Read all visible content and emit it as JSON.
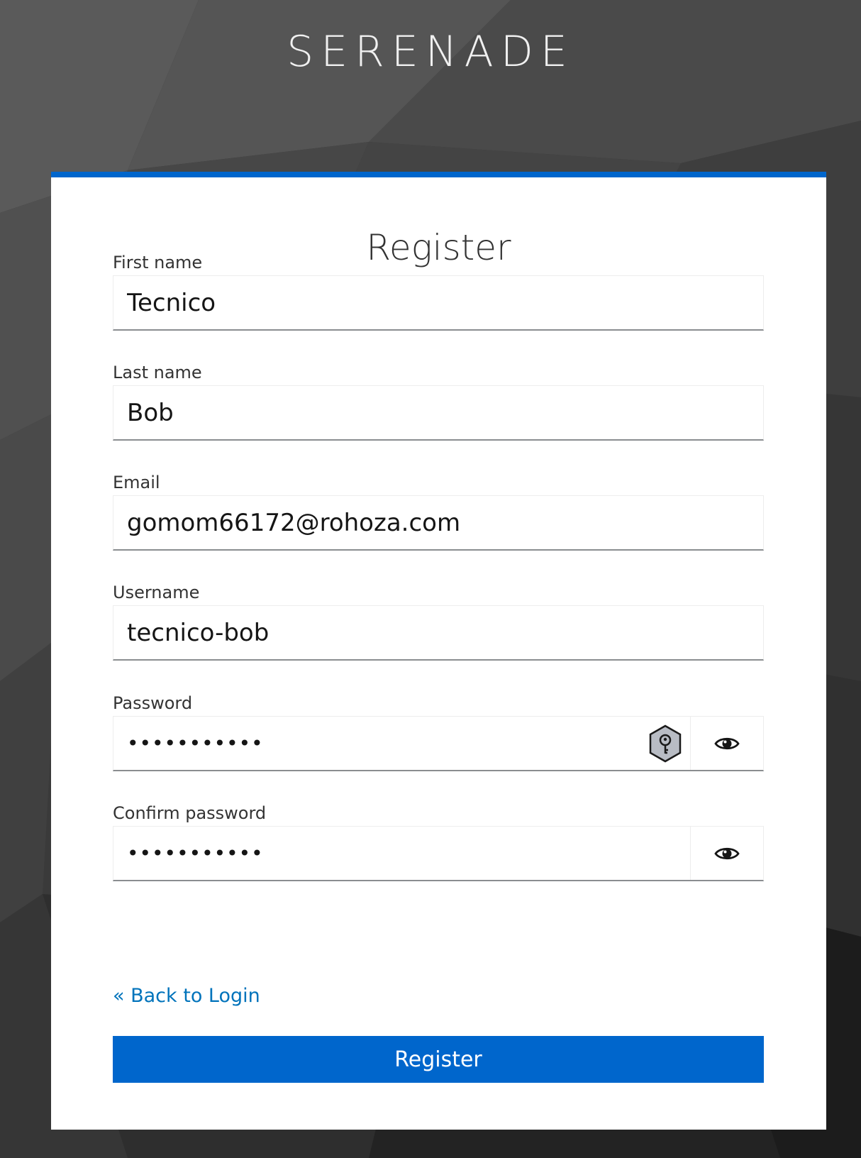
{
  "brand": {
    "title": "SERENADE"
  },
  "form": {
    "title": "Register",
    "fields": {
      "first_name": {
        "label": "First name",
        "value": "Tecnico"
      },
      "last_name": {
        "label": "Last name",
        "value": "Bob"
      },
      "email": {
        "label": "Email",
        "value": "gomom66172@rohoza.com"
      },
      "username": {
        "label": "Username",
        "value": "tecnico-bob"
      },
      "password": {
        "label": "Password",
        "value": "•••••••••••"
      },
      "confirm_password": {
        "label": "Confirm password",
        "value": "•••••••••••"
      }
    },
    "back_link": "« Back to Login",
    "submit_label": "Register"
  },
  "icons": {
    "password_manager": "key-icon",
    "show_password": "eye-icon"
  },
  "colors": {
    "accent": "#0066cc",
    "link": "#0073bb",
    "background": "#2c2c2c"
  }
}
